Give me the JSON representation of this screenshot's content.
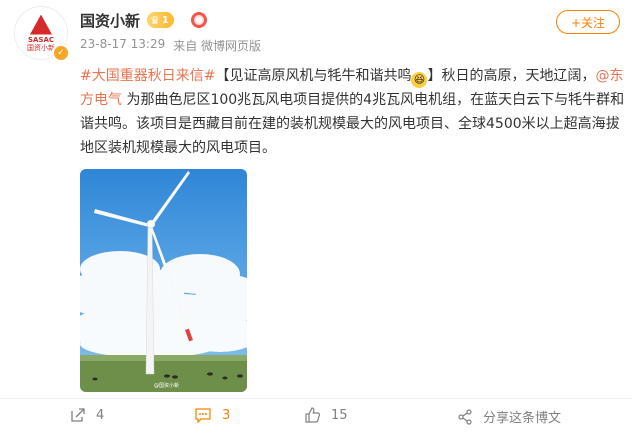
{
  "account": {
    "name": "国资小新",
    "badge_level": "1",
    "avatar_logo_text": "SASAC",
    "avatar_logo_sub": "国资小新",
    "timestamp": "23-8-17 13:29",
    "source": "来自 微博网页版"
  },
  "follow_button": {
    "label": "+关注"
  },
  "post": {
    "hashtag": "#大国重器秋日来信#",
    "text_1": "【见证高原风机与牦牛和谐共鸣",
    "text_2": "】秋日的高原，天地辽阔，",
    "mention": "@东方电气",
    "text_3": " 为那曲色尼区100兆瓦风电项目提供的4兆瓦风电机组，在蓝天白云下与牦牛群和谐共鸣。该项目是西藏目前在建的装机规模最大的风电项目、全球4500米以上超高海拔地区装机规模最大的风电项目。"
  },
  "image": {
    "watermark": "@国资小新"
  },
  "actions": {
    "share_count": "4",
    "comment_count": "3",
    "like_count": "15",
    "share_post_label": "分享这条博文"
  },
  "colors": {
    "accent": "#ff8200",
    "link": "#eb7350",
    "meta": "#939393"
  }
}
